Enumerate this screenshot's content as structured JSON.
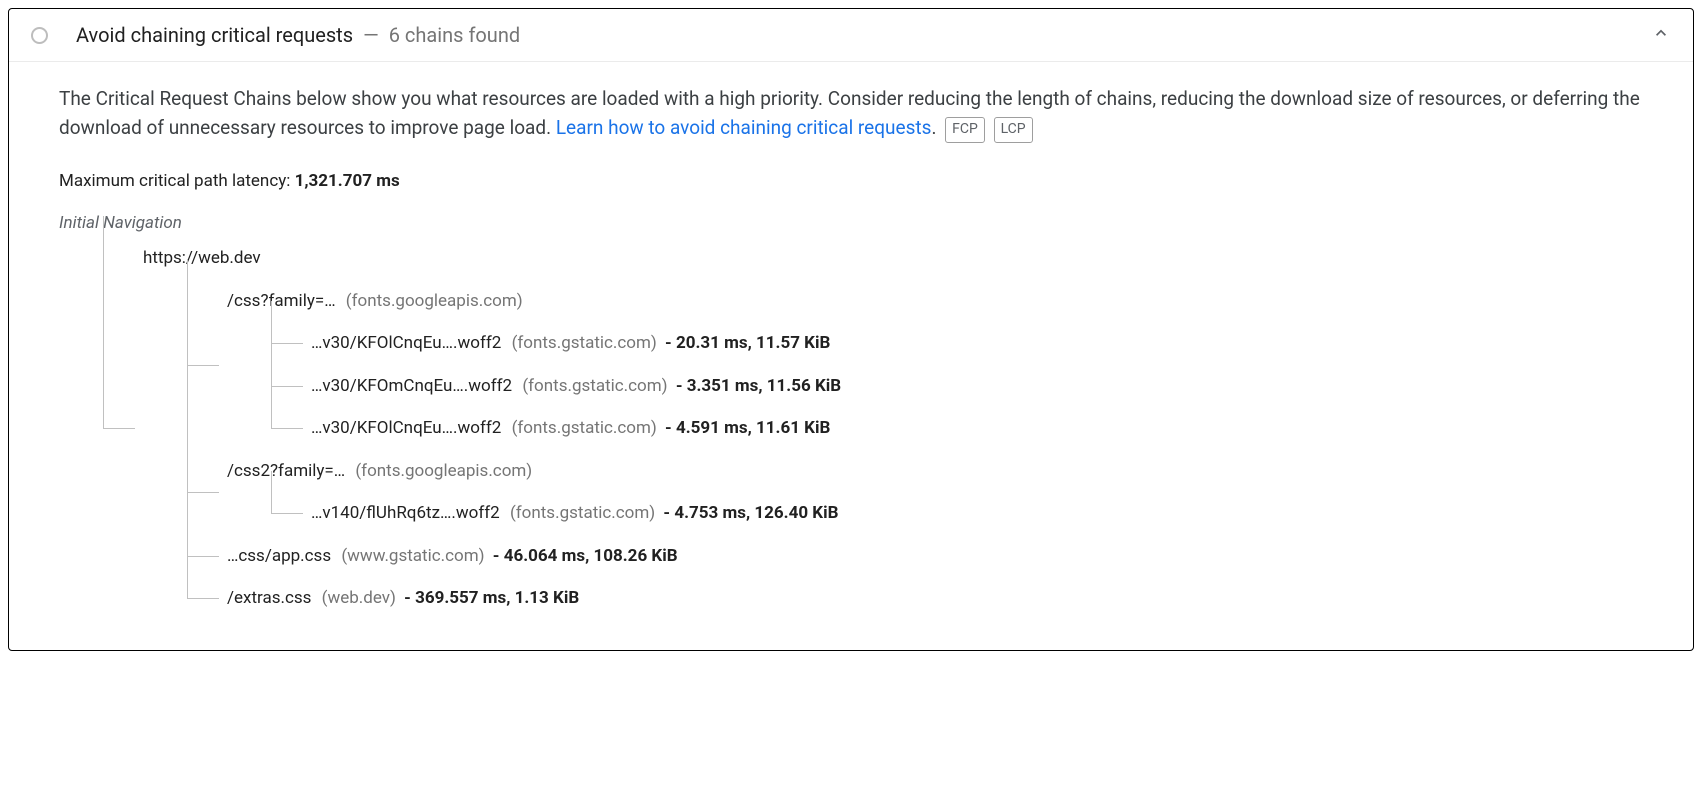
{
  "header": {
    "title": "Avoid chaining critical requests",
    "separator": "—",
    "count_label": "6 chains found"
  },
  "description": {
    "text_before_link": "The Critical Request Chains below show you what resources are loaded with a high priority. Consider reducing the length of chains, reducing the download size of resources, or deferring the download of unnecessary resources to improve page load. ",
    "link_text": "Learn how to avoid chaining critical requests",
    "text_after_link": ".",
    "pills": [
      "FCP",
      "LCP"
    ]
  },
  "latency": {
    "label": "Maximum critical path latency: ",
    "value": "1,321.707 ms"
  },
  "tree": {
    "root_label": "Initial Navigation",
    "root_node": {
      "path": "https://web.dev",
      "host": "",
      "stats": ""
    },
    "level1": [
      {
        "path": "/css?family=…",
        "host": "(fonts.googleapis.com)",
        "stats": "",
        "children": [
          {
            "path": "…v30/KFOlCnqEu….woff2",
            "host": "(fonts.gstatic.com)",
            "stats": "- 20.31 ms, 11.57 KiB"
          },
          {
            "path": "…v30/KFOmCnqEu….woff2",
            "host": "(fonts.gstatic.com)",
            "stats": "- 3.351 ms, 11.56 KiB"
          },
          {
            "path": "…v30/KFOlCnqEu….woff2",
            "host": "(fonts.gstatic.com)",
            "stats": "- 4.591 ms, 11.61 KiB"
          }
        ]
      },
      {
        "path": "/css2?family=…",
        "host": "(fonts.googleapis.com)",
        "stats": "",
        "children": [
          {
            "path": "…v140/flUhRq6tz….woff2",
            "host": "(fonts.gstatic.com)",
            "stats": "- 4.753 ms, 126.40 KiB"
          }
        ]
      },
      {
        "path": "…css/app.css",
        "host": "(www.gstatic.com)",
        "stats": "- 46.064 ms, 108.26 KiB",
        "children": []
      },
      {
        "path": "/extras.css",
        "host": "(web.dev)",
        "stats": "- 369.557 ms, 1.13 KiB",
        "children": []
      }
    ]
  }
}
